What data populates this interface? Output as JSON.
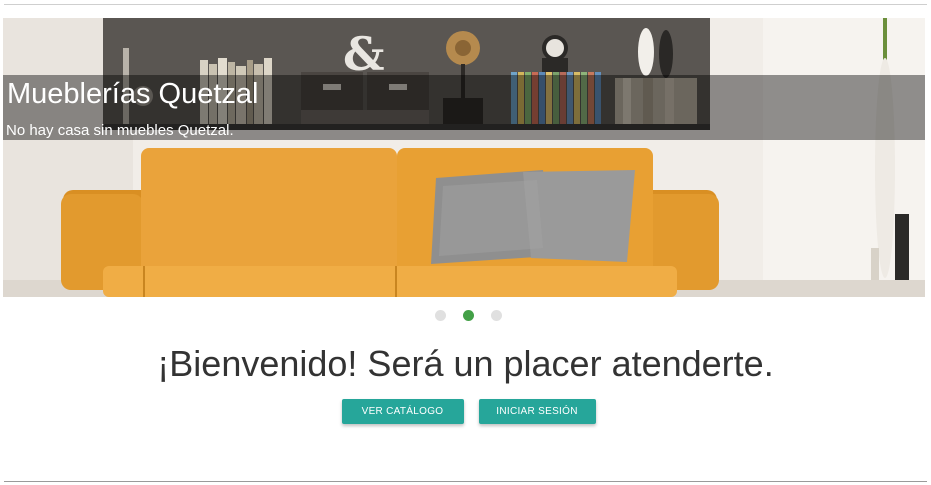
{
  "hero": {
    "title": "Mueblerías Quetzal",
    "subtitle": "No hay casa sin muebles Quetzal.",
    "slides_total": 3,
    "active_slide": 2
  },
  "welcome": {
    "heading": "¡Bienvenido! Será un placer atenderte."
  },
  "actions": {
    "catalog_label": "VER CATÁLOGO",
    "login_label": "INICIAR SESIÓN"
  },
  "colors": {
    "accent": "#26a69a",
    "indicator_active": "#43a047",
    "indicator_inactive": "#e0e0e0",
    "sofa": "#e8a23a",
    "pillow": "#8f8f8f"
  }
}
